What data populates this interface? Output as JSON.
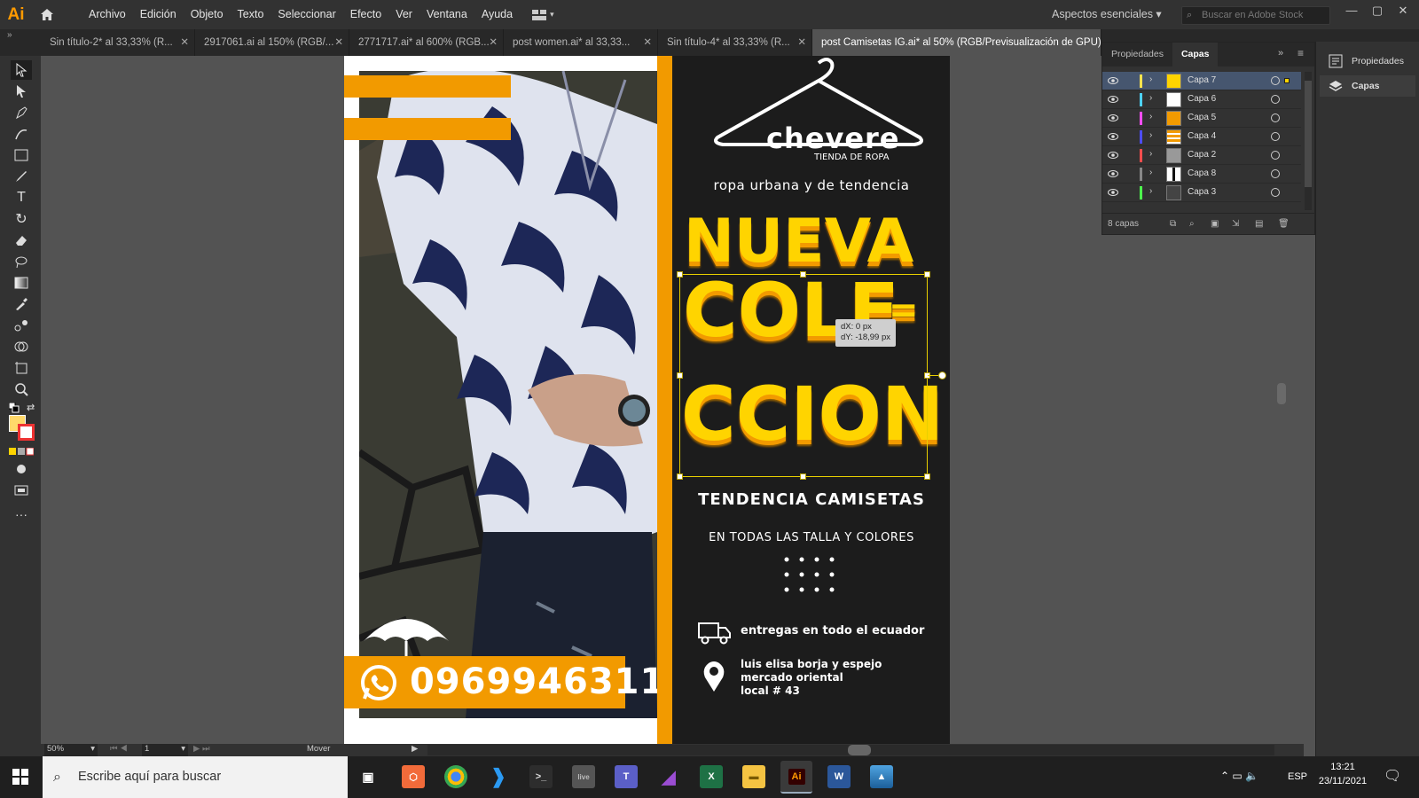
{
  "app": {
    "logo": "Ai",
    "menu": [
      "Archivo",
      "Edición",
      "Objeto",
      "Texto",
      "Seleccionar",
      "Efecto",
      "Ver",
      "Ventana",
      "Ayuda"
    ],
    "workspace": "Aspectos esenciales",
    "stock_placeholder": "Buscar en Adobe Stock",
    "accent": "#ff9a00"
  },
  "tabs": [
    {
      "label": "Sin título-2* al 33,33% (R..."
    },
    {
      "label": "2917061.ai al 150% (RGB/..."
    },
    {
      "label": "2771717.ai* al 600% (RGB..."
    },
    {
      "label": "post women.ai* al 33,33..."
    },
    {
      "label": "Sin título-4* al 33,33% (R..."
    },
    {
      "label": "post Camisetas IG.ai* al 50% (RGB/Previsualización de GPU)"
    }
  ],
  "poster": {
    "brand": "chevere",
    "brand_sub": "TIENDA DE ROPA",
    "tagline": "ropa urbana y de tendencia",
    "headline1": "NUEVA",
    "headline2": "COLE",
    "headline2_dash": "=",
    "headline3": "CCION",
    "subtitle": "TENDENCIA CAMISETAS",
    "sizes": "EN TODAS LAS TALLA Y COLORES",
    "delivery": "entregas en todo el ecuador",
    "address1": "luis elisa borja y espejo",
    "address2": "mercado oriental",
    "address3": "local # 43",
    "phone": "0969946311",
    "orange": "#f29a00",
    "yellow": "#ffd400"
  },
  "tooltip": {
    "dx": "dX: 0 px",
    "dy": "dY: -18,99 px"
  },
  "layers_panel": {
    "tab_props": "Propiedades",
    "tab_layers": "Capas",
    "layers": [
      {
        "name": "Capa 7",
        "color": "#ffe34d"
      },
      {
        "name": "Capa 6",
        "color": "#4dd2ff"
      },
      {
        "name": "Capa 5",
        "color": "#ff4dff"
      },
      {
        "name": "Capa 4",
        "color": "#4d4dff"
      },
      {
        "name": "Capa 2",
        "color": "#ff4d4d"
      },
      {
        "name": "Capa 8",
        "color": "#888888"
      },
      {
        "name": "Capa 3",
        "color": "#4dff4d"
      }
    ],
    "count": "8 capas"
  },
  "dock": {
    "properties": "Propiedades",
    "layers": "Capas"
  },
  "status": {
    "zoom": "50%",
    "page": "1",
    "tool": "Mover"
  },
  "taskbar": {
    "search_placeholder": "Escribe aquí para buscar",
    "lang": "ESP",
    "time": "13:21",
    "date": "23/11/2021"
  }
}
